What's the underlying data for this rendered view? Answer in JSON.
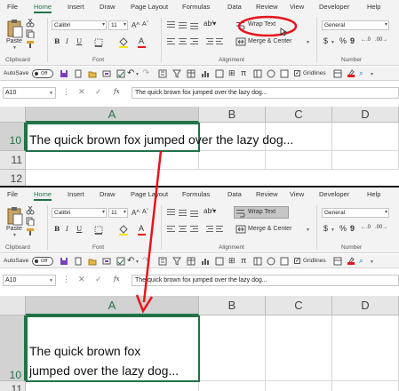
{
  "ribbon": {
    "tabs": [
      "File",
      "Home",
      "Insert",
      "Draw",
      "Page Layout",
      "Formulas",
      "Data",
      "Review",
      "View",
      "Developer",
      "Help"
    ],
    "active_tab": "Home",
    "clipboard": {
      "paste_label": "Paste",
      "group_label": "Clipboard"
    },
    "font": {
      "font_name": "Calibri",
      "font_size": "11",
      "bold": "B",
      "italic": "I",
      "underline": "U",
      "font_color_letter": "A",
      "group_label": "Font"
    },
    "alignment": {
      "wrap_text_label": "Wrap Text",
      "merge_label": "Merge & Center",
      "group_label": "Alignment"
    },
    "number": {
      "format": "General",
      "currency": "$",
      "percent": "%",
      "comma": "9",
      "group_label": "Number"
    }
  },
  "qat": {
    "autosave_label": "AutoSave",
    "autosave_state": "Off",
    "gridlines_label": "Gridlines"
  },
  "formula_bar": {
    "name_box": "A10",
    "fx": "fx",
    "formula": "The quick brown fox jumped over the lazy dog..."
  },
  "sheet_before": {
    "columns": [
      "A",
      "B",
      "C",
      "D"
    ],
    "rows": [
      "10",
      "11",
      "12"
    ],
    "cell_text": "The quick brown fox jumped over the lazy dog..."
  },
  "sheet_after": {
    "columns": [
      "A",
      "B",
      "C",
      "D"
    ],
    "rows": [
      "10",
      "11"
    ],
    "cell_line1": "The quick brown fox",
    "cell_line2": "jumped over the lazy dog..."
  },
  "colors": {
    "excel_green": "#217346",
    "annotation_red": "#e8141c",
    "ribbon_bg": "#f3f3f3"
  }
}
